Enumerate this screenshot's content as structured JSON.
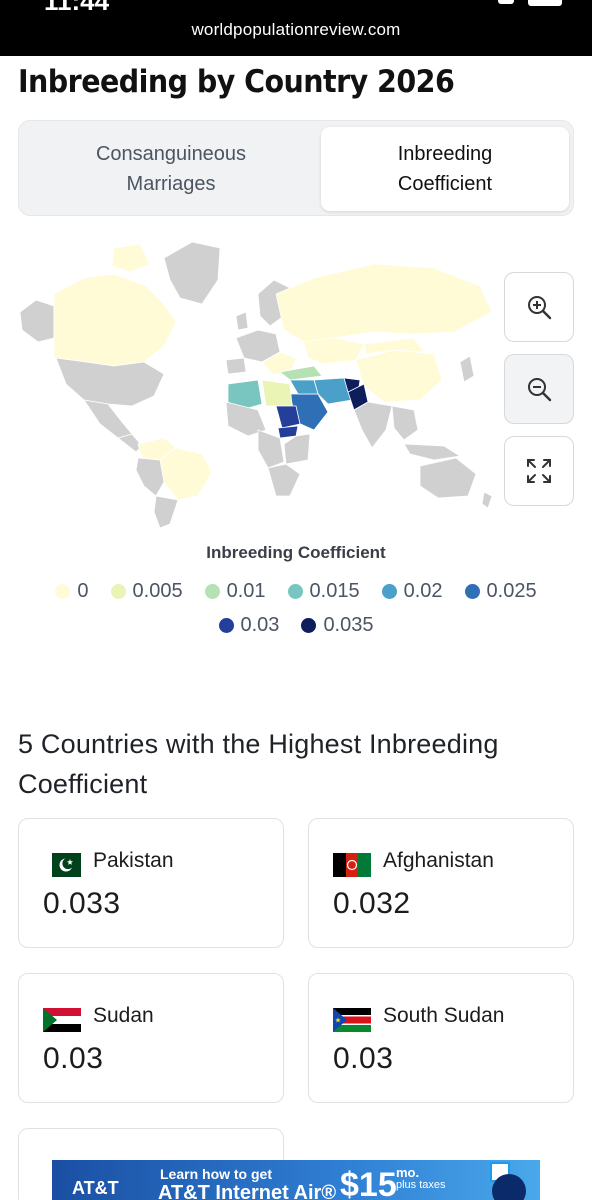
{
  "browser": {
    "url": "worldpopulationreview.com",
    "time": "11:44"
  },
  "page": {
    "title": "Inbreeding by Country 2026"
  },
  "tabs": [
    {
      "label": "Consanguineous\nMarriages"
    },
    {
      "label": "Inbreeding\nCoefficient"
    }
  ],
  "map": {
    "zoom_in_icon": "zoom-in-icon",
    "zoom_out_icon": "zoom-out-icon",
    "fullscreen_icon": "fullscreen-icon"
  },
  "legend": {
    "title": "Inbreeding Coefficient",
    "items": [
      {
        "label": "0",
        "color": "#fffbd6"
      },
      {
        "label": "0.005",
        "color": "#eaf4b4"
      },
      {
        "label": "0.01",
        "color": "#b6e1b2"
      },
      {
        "label": "0.015",
        "color": "#79c5bf"
      },
      {
        "label": "0.02",
        "color": "#4aa0c8"
      },
      {
        "label": "0.025",
        "color": "#2f6fb5"
      },
      {
        "label": "0.03",
        "color": "#233f9a"
      },
      {
        "label": "0.035",
        "color": "#0e1d5c"
      }
    ]
  },
  "section": {
    "title": "5 Countries with the Highest Inbreeding Coefficient"
  },
  "countries": [
    {
      "name": "Pakistan",
      "value": "0.033"
    },
    {
      "name": "Afghanistan",
      "value": "0.032"
    },
    {
      "name": "Sudan",
      "value": "0.03"
    },
    {
      "name": "South Sudan",
      "value": "0.03"
    }
  ],
  "ad": {
    "brand": "AT&T",
    "line1": "Learn how to get",
    "line2": "AT&T Internet Air®",
    "price": "$15",
    "per": "mo.",
    "terms": "plus taxes"
  }
}
